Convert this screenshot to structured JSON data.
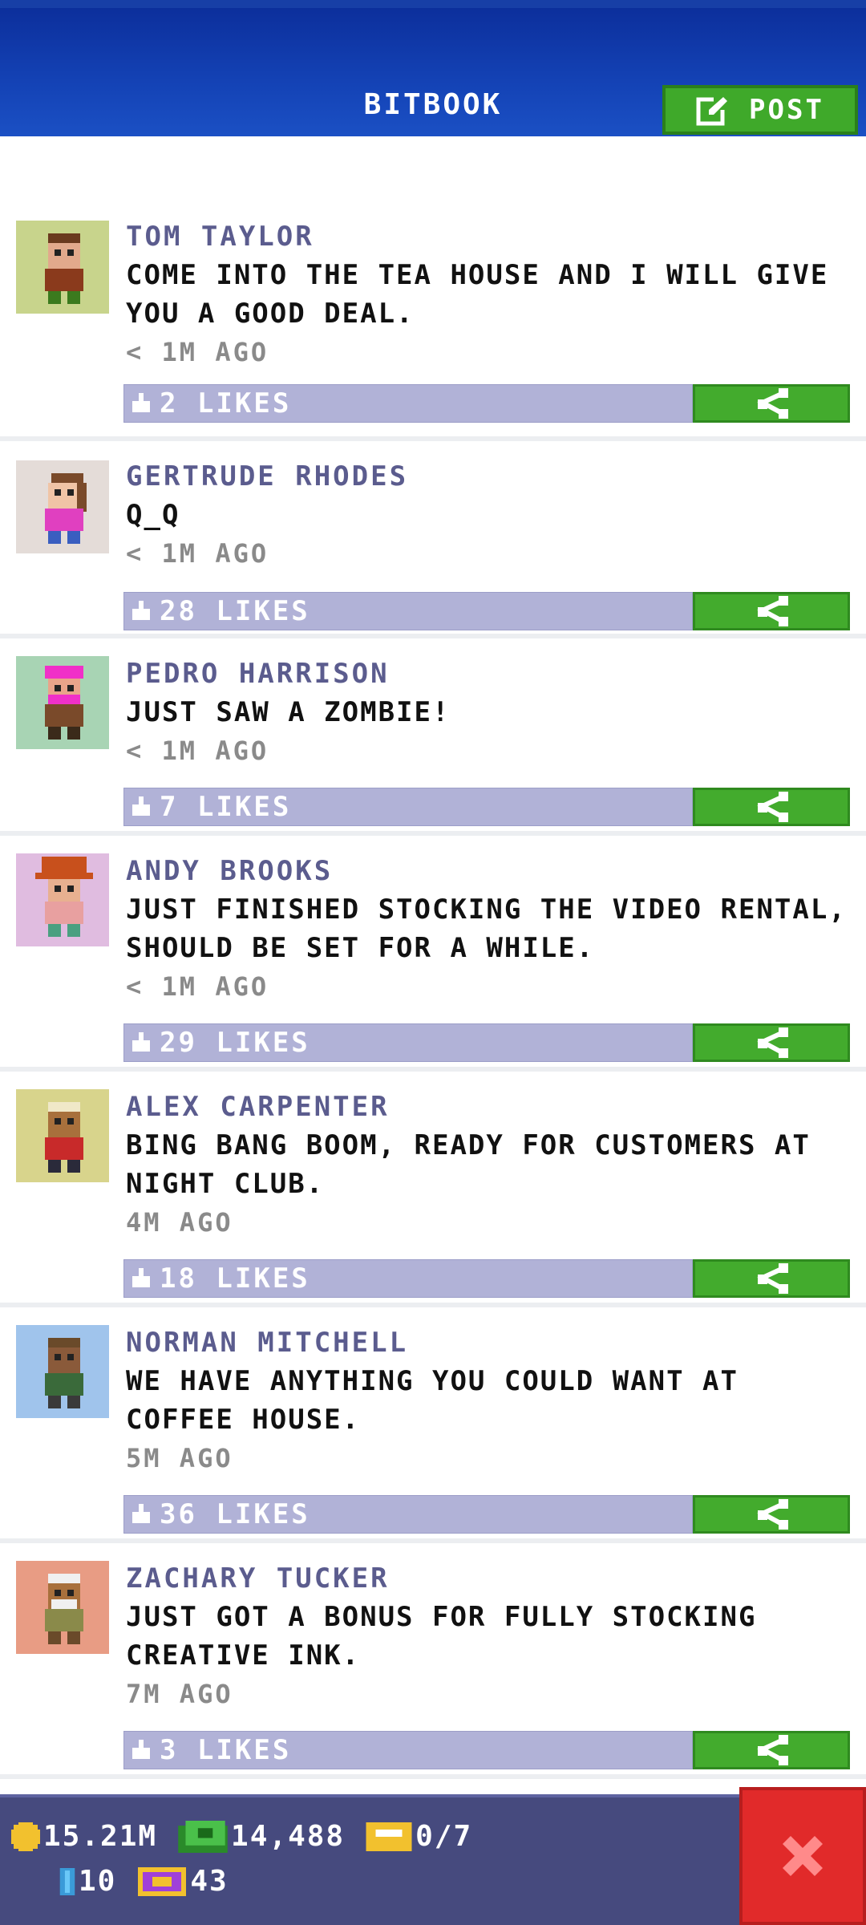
{
  "header": {
    "title": "BITBOOK",
    "post_label": "POST"
  },
  "posts": [
    {
      "name": "TOM TAYLOR",
      "message": "COME INTO THE TEA HOUSE AND I WILL GIVE YOU A GOOD DEAL.",
      "time": "< 1M AGO",
      "likes": "2 LIKES",
      "avatar_bg": "#c8d48c"
    },
    {
      "name": "GERTRUDE RHODES",
      "message": "Q_Q",
      "time": "< 1M AGO",
      "likes": "28 LIKES",
      "avatar_bg": "#e4dcd8"
    },
    {
      "name": "PEDRO HARRISON",
      "message": "JUST SAW A ZOMBIE!",
      "time": "< 1M AGO",
      "likes": "7 LIKES",
      "avatar_bg": "#a8d4b4"
    },
    {
      "name": "ANDY BROOKS",
      "message": "JUST FINISHED STOCKING THE VIDEO RENTAL, SHOULD BE SET FOR A WHILE.",
      "time": "< 1M AGO",
      "likes": "29 LIKES",
      "avatar_bg": "#e0bce0"
    },
    {
      "name": "ALEX CARPENTER",
      "message": "BING BANG BOOM, READY FOR CUSTOMERS AT NIGHT CLUB.",
      "time": "4M AGO",
      "likes": "18 LIKES",
      "avatar_bg": "#d8d48c"
    },
    {
      "name": "NORMAN MITCHELL",
      "message": "WE HAVE ANYTHING YOU COULD WANT AT COFFEE HOUSE.",
      "time": "5M AGO",
      "likes": "36 LIKES",
      "avatar_bg": "#a0c4ec"
    },
    {
      "name": "ZACHARY TUCKER",
      "message": "JUST GOT A BONUS FOR FULLY STOCKING CREATIVE INK.",
      "time": "7M AGO",
      "likes": "3 LIKES",
      "avatar_bg": "#e89c84"
    }
  ],
  "status": {
    "coins": "15.21M",
    "cash": "14,488",
    "tickets": "0/7",
    "elevator": "10",
    "bux": "43"
  },
  "icons": {
    "post": "edit-icon",
    "like": "thumbs-up-icon",
    "share": "share-icon",
    "close": "close-icon",
    "coin": "coin-icon",
    "cash": "cash-icon",
    "ticket": "ticket-icon",
    "elevator": "elevator-icon",
    "bux": "bux-icon"
  }
}
